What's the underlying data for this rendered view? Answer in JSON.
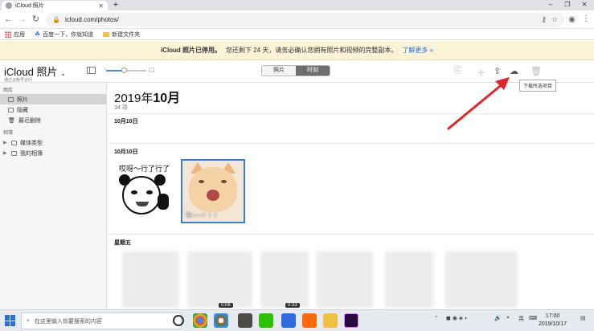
{
  "browser": {
    "tab_title": "iCloud 照片",
    "url": "icloud.com/photos/",
    "bookmarks": [
      {
        "label": "应用",
        "icon": "apps-grid-icon"
      },
      {
        "label": "百度一下，你就知道",
        "icon": "baidu-paw-icon"
      },
      {
        "label": "新建文件夹",
        "icon": "folder-icon"
      }
    ]
  },
  "banner": {
    "bold": "iCloud 照片已停用。",
    "text": "您还剩下 24 天，请务必确认您拥有照片和视频的完整副本。",
    "link": "了解更多 »"
  },
  "app": {
    "brand": "iCloud",
    "brand_suffix": "照片",
    "brand_sub": "通过云账号访问",
    "segments": [
      "照片",
      "时刻"
    ],
    "active_segment": 1,
    "tooltip": "下载所选项目",
    "zoom_level": 0.45
  },
  "sidebar": {
    "library_header": "图库",
    "library_items": [
      "照片",
      "隐藏",
      "最近删除"
    ],
    "albums_header": "相簿",
    "album_items": [
      "媒体类型",
      "我的相簿"
    ]
  },
  "main": {
    "year": "2019年",
    "month": "10月",
    "count": "34 项",
    "groups": [
      "10月10日",
      "10月10日",
      "星期五"
    ],
    "meme_text": "哎呀～行了行了",
    "cat_caption": "啊——！！！",
    "video_durations": [
      "0:08",
      "0:33"
    ]
  },
  "taskbar": {
    "search_placeholder": "在这里输入你要搜索的内容",
    "ime": "英",
    "time": "17:00",
    "date": "2019/10/17"
  },
  "colors": {
    "accent": "#1a6ee8",
    "banner_bg": "#fbf3d6",
    "annotation_arrow": "#e3242b",
    "selection_border": "#3b7bd9"
  }
}
